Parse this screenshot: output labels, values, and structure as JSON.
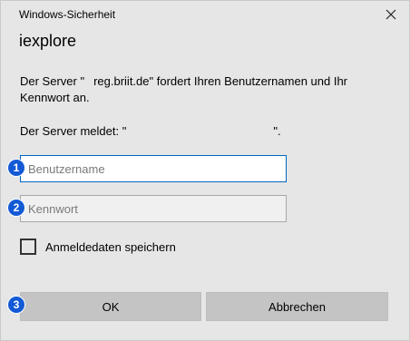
{
  "dialog": {
    "window_title": "Windows-Sicherheit",
    "close_icon": "close-icon",
    "app_name": "iexplore",
    "message_part1": "Der Server \"",
    "message_part2": "reg.briit.de\" fordert Ihren Benutzernamen und Ihr Kennwort an.",
    "server_says_prefix": "Der Server meldet: \"",
    "server_says_suffix": "\"."
  },
  "form": {
    "username_placeholder": "Benutzername",
    "username_value": "",
    "password_placeholder": "Kennwort",
    "password_value": "",
    "remember_label": "Anmeldedaten speichern",
    "remember_checked": false
  },
  "buttons": {
    "ok_label": "OK",
    "cancel_label": "Abbrechen"
  },
  "badges": {
    "one": "1",
    "two": "2",
    "three": "3"
  },
  "colors": {
    "dialog_bg": "#e6e6e6",
    "badge_bg": "#1359d6",
    "focus_border": "#0067c0",
    "button_bg": "#c4c4c4"
  }
}
